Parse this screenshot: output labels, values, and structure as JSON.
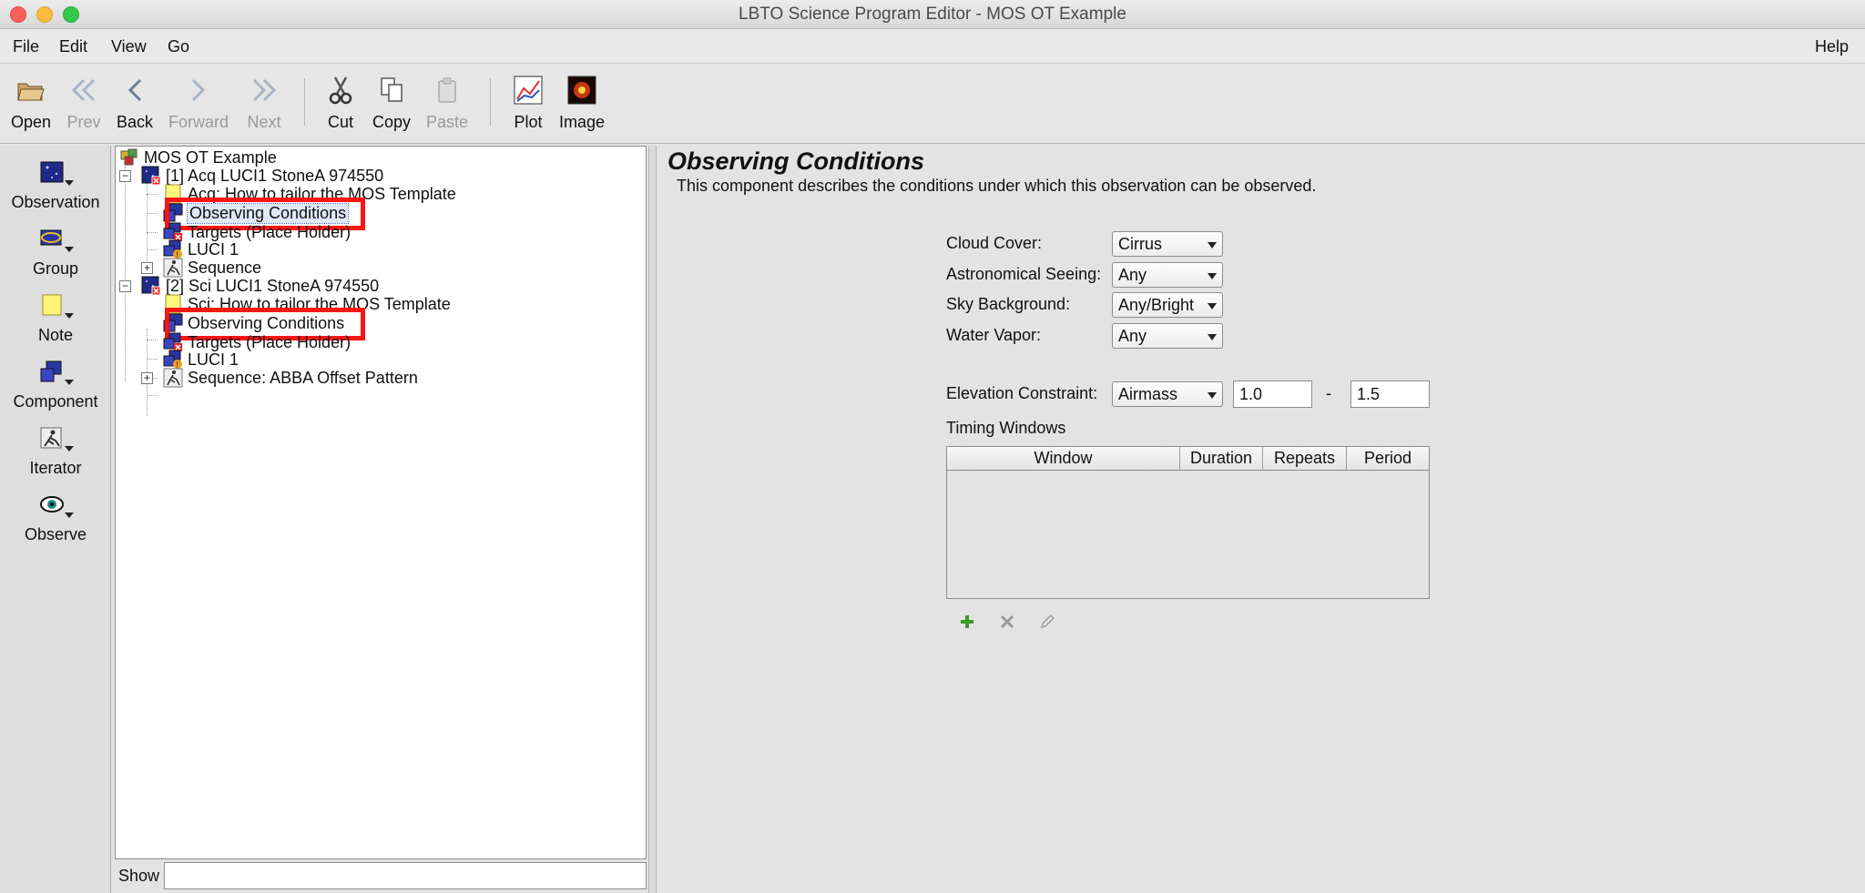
{
  "window": {
    "title": "LBTO Science Program Editor - MOS OT Example"
  },
  "menubar": {
    "file": "File",
    "edit": "Edit",
    "view": "View",
    "go": "Go",
    "help": "Help"
  },
  "toolbar": {
    "open": "Open",
    "prev": "Prev",
    "back": "Back",
    "forward": "Forward",
    "next": "Next",
    "cut": "Cut",
    "copy": "Copy",
    "paste": "Paste",
    "plot": "Plot",
    "image": "Image"
  },
  "palette": {
    "observation": "Observation",
    "group": "Group",
    "note": "Note",
    "component": "Component",
    "iterator": "Iterator",
    "observe": "Observe"
  },
  "tree": {
    "root": "MOS OT Example",
    "obs1": {
      "label": "[1] Acq LUCI1 StoneA 974550",
      "note": "Acq: How to tailor the MOS Template",
      "conditions": "Observing Conditions",
      "targets": "Targets (Place Holder)",
      "instrument": "LUCI 1",
      "sequence": "Sequence"
    },
    "obs2": {
      "label": "[2] Sci LUCI1 StoneA 974550",
      "note": "Sci: How to tailor the MOS Template",
      "conditions": "Observing Conditions",
      "targets": "Targets (Place Holder)",
      "instrument": "LUCI 1",
      "sequence": "Sequence: ABBA Offset Pattern"
    }
  },
  "show": {
    "label": "Show",
    "value": ""
  },
  "editor": {
    "title": "Observing Conditions",
    "description": "This component describes the conditions under which this observation can be observed.",
    "cloud_cover": {
      "label": "Cloud Cover:",
      "value": "Cirrus"
    },
    "seeing": {
      "label": "Astronomical Seeing:",
      "value": "Any"
    },
    "sky": {
      "label": "Sky Background:",
      "value": "Any/Bright"
    },
    "water": {
      "label": "Water Vapor:",
      "value": "Any"
    },
    "elevation": {
      "label": "Elevation Constraint:",
      "type": "Airmass",
      "min": "1.0",
      "separator": "-",
      "max": "1.5"
    },
    "timing": {
      "label": "Timing Windows",
      "columns": [
        "Window",
        "Duration",
        "Repeats",
        "Period"
      ],
      "rows": []
    }
  },
  "colors": {
    "highlight": "#ff1414",
    "selection_bg": "#dfe8f7",
    "add_green": "#3a9a2a"
  }
}
